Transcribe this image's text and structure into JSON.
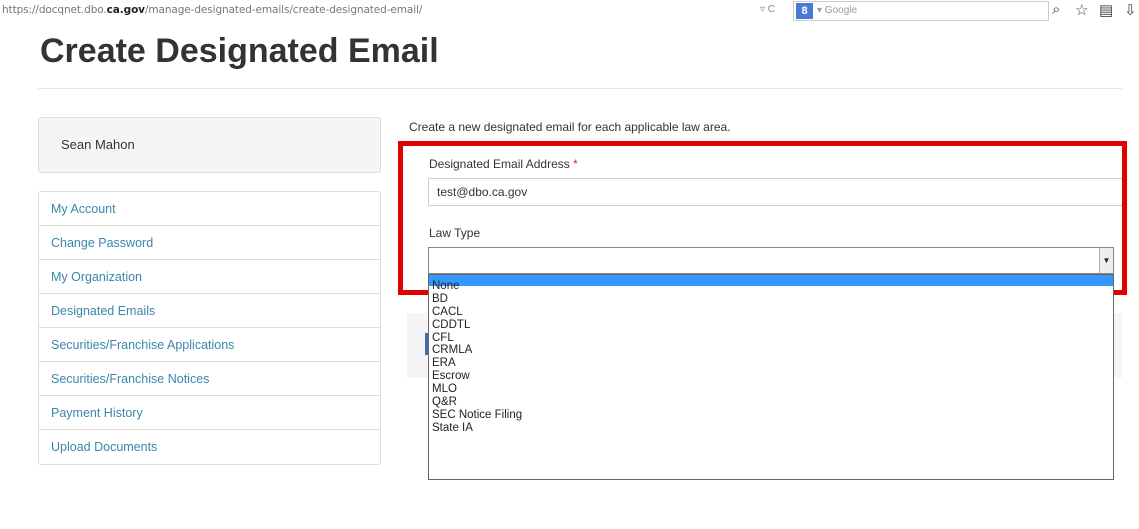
{
  "browser": {
    "url_prefix": "https://docqnet.dbo.",
    "url_domain": "ca.gov",
    "url_path": "/manage-designated-emails/create-designated-email/",
    "url_controls": "▿ C",
    "search_engine_glyph": "8",
    "search_placeholder": "▾ Google",
    "search_icon": "search-icon",
    "star_icon": "star-icon",
    "bookmarks_icon": "bookmarks-icon",
    "download_icon": "download-icon"
  },
  "page": {
    "title": "Create Designated Email"
  },
  "sidebar": {
    "user_name": "Sean Mahon",
    "items": [
      {
        "label": "My Account"
      },
      {
        "label": "Change Password"
      },
      {
        "label": "My Organization"
      },
      {
        "label": "Designated Emails"
      },
      {
        "label": "Securities/Franchise Applications"
      },
      {
        "label": "Securities/Franchise Notices"
      },
      {
        "label": "Payment History"
      },
      {
        "label": "Upload Documents"
      }
    ]
  },
  "form": {
    "intro": "Create a new designated email for each applicable law area.",
    "email_label": "Designated Email Address",
    "required_mark": "*",
    "email_value": "test@dbo.ca.gov",
    "law_type_label": "Law Type",
    "law_type_selected": "",
    "options": [
      "None",
      "BD",
      "CACL",
      "CDDTL",
      "CFL",
      "CRMLA",
      "ERA",
      "Escrow",
      "MLO",
      "Q&R",
      "SEC Notice Filing",
      "State IA"
    ]
  },
  "colors": {
    "link": "#3a87ad",
    "highlight_box": "#e00000",
    "selected_option": "#3399ff"
  }
}
